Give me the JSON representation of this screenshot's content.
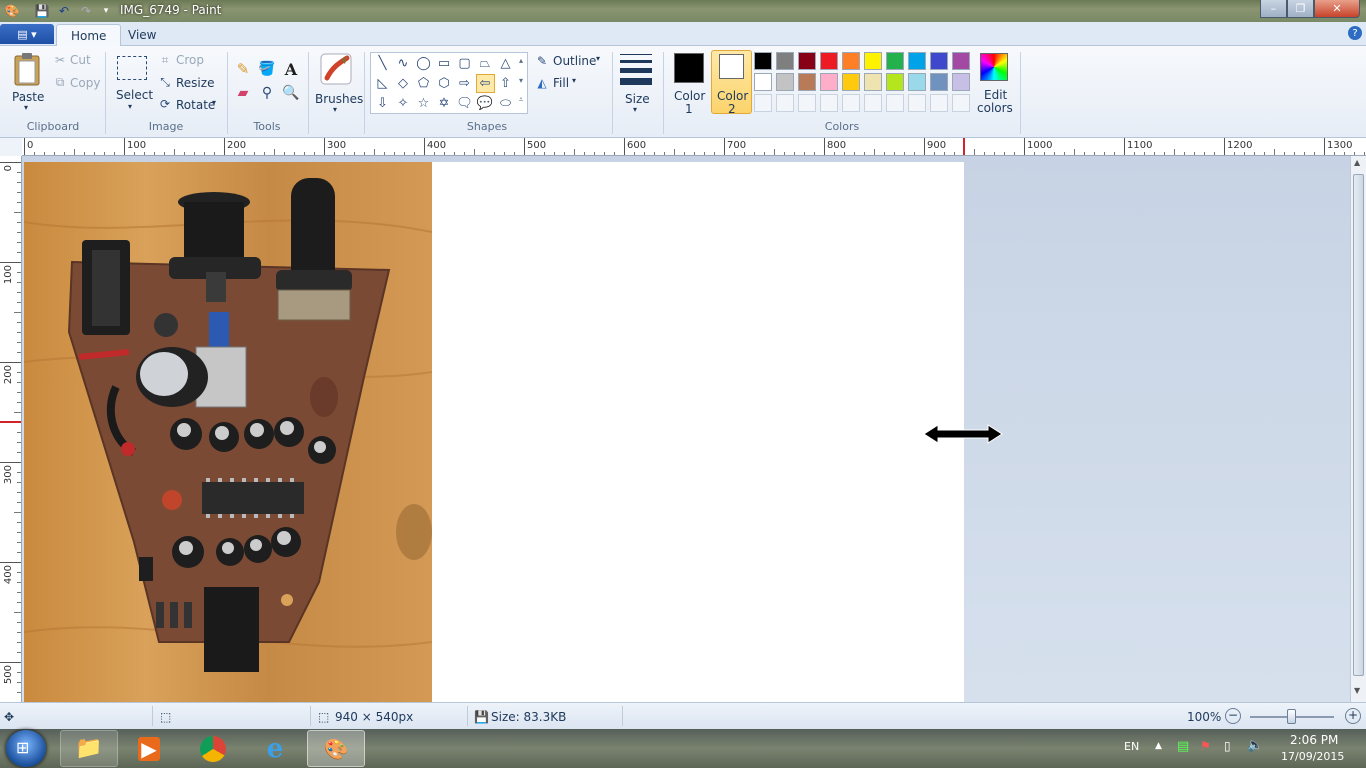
{
  "window": {
    "title": "IMG_6749 - Paint",
    "min_symbol": "–",
    "max_symbol": "❐",
    "close_symbol": "✕"
  },
  "tabs": {
    "file": "▤ ▾",
    "home": "Home",
    "view": "View",
    "help": "?"
  },
  "clipboard": {
    "paste": "Paste",
    "cut": "Cut",
    "copy": "Copy",
    "label": "Clipboard"
  },
  "image": {
    "select": "Select",
    "crop": "Crop",
    "resize": "Resize",
    "rotate": "Rotate",
    "label": "Image"
  },
  "tools": {
    "label": "Tools",
    "text_glyph": "A"
  },
  "brushes": {
    "label": "Brushes"
  },
  "shapes": {
    "outline": "Outline",
    "fill": "Fill",
    "label": "Shapes",
    "glyphs": [
      "╲",
      "∿",
      "◯",
      "▭",
      "▢",
      "⏢",
      "△",
      "◺",
      "◇",
      "⬠",
      "⬡",
      "⇨",
      "⇦",
      "⇧",
      "⇩",
      "✧",
      "☆",
      "✡",
      "🗨",
      "💬",
      "⬭"
    ]
  },
  "size": {
    "label": "Size"
  },
  "colors": {
    "color1_line1": "Color",
    "color1_line2": "1",
    "color2_line1": "Color",
    "color2_line2": "2",
    "color1": "#000000",
    "color2": "#ffffff",
    "edit_line1": "Edit",
    "edit_line2": "colors",
    "label": "Colors",
    "palette_row1": [
      "#000000",
      "#7f7f7f",
      "#880015",
      "#ed1c24",
      "#ff7f27",
      "#fff200",
      "#22b14c",
      "#00a2e8",
      "#3f48cc",
      "#a349a4"
    ],
    "palette_row2": [
      "#ffffff",
      "#c3c3c3",
      "#b97a57",
      "#ffaec9",
      "#ffc90e",
      "#efe4b0",
      "#b5e61d",
      "#99d9ea",
      "#7092be",
      "#c8bfe7"
    ]
  },
  "ruler": {
    "top": [
      "0",
      "100",
      "200",
      "300",
      "400",
      "500",
      "600",
      "700",
      "800",
      "900",
      "1000",
      "1100",
      "1200",
      "1300"
    ],
    "left": [
      "0",
      "100",
      "200",
      "300",
      "400",
      "500"
    ]
  },
  "status": {
    "dimensions": "940 × 540px",
    "size": "Size: 83.3KB",
    "zoom": "100%"
  },
  "taskbar": {
    "lang": "EN",
    "time": "2:06 PM",
    "date": "17/09/2015"
  }
}
